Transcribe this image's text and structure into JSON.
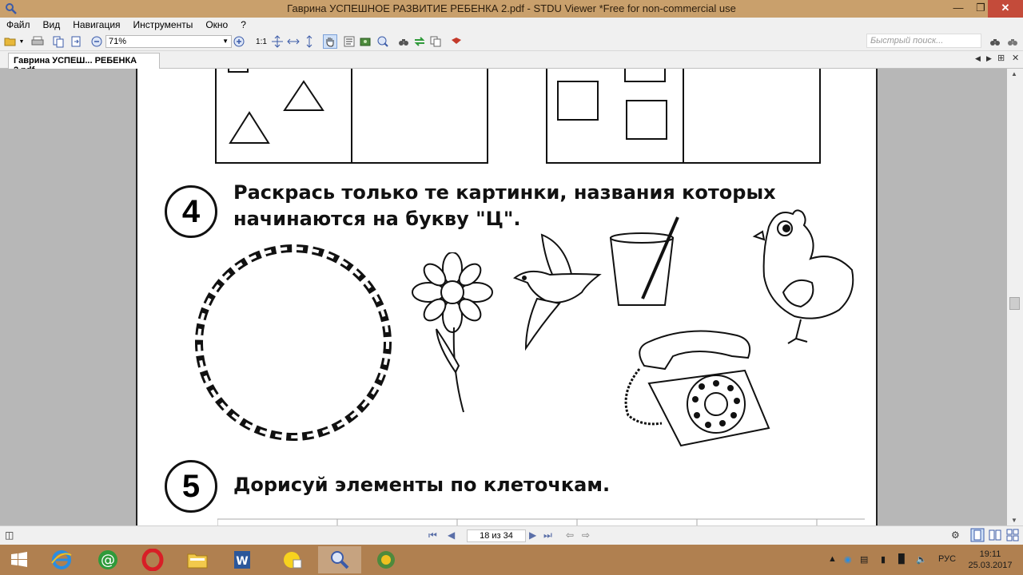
{
  "window": {
    "title": "Гаврина УСПЕШНОЕ РАЗВИТИЕ РЕБЕНКА 2.pdf - STDU Viewer *Free for non-commercial use"
  },
  "menu": {
    "items": [
      {
        "label": "Файл"
      },
      {
        "label": "Вид"
      },
      {
        "label": "Навигация"
      },
      {
        "label": "Инструменты"
      },
      {
        "label": "Окно"
      },
      {
        "label": "?"
      }
    ]
  },
  "toolbar": {
    "zoom_value": "71%",
    "actual_size_label": "1:1",
    "search_placeholder": "Быстрый поиск..."
  },
  "tabs": [
    {
      "label": "Гаврина УСПЕШ... РЕБЕНКА 2.pdf",
      "active": true
    }
  ],
  "document": {
    "exercise4": {
      "number": "4",
      "line1": "Раскрась только те картинки, названия которых",
      "line2": "начинаются на букву \"Ц\"."
    },
    "exercise5": {
      "number": "5",
      "line1": "Дорисуй элементы по клеточкам."
    }
  },
  "statusbar": {
    "page_indicator": "18 из 34"
  },
  "taskbar": {
    "language": "РУС",
    "time": "19:11",
    "date": "25.03.2017"
  }
}
